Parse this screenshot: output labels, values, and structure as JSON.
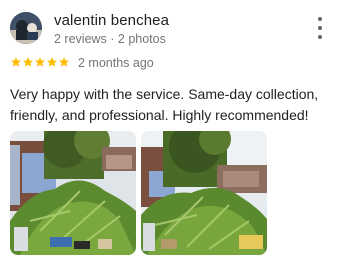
{
  "review": {
    "reviewer_name": "valentin benchea",
    "reviewer_meta": "2 reviews · 2 photos",
    "rating": 5,
    "rating_max": 5,
    "time_ago": "2 months ago",
    "text": "Very happy with the service. Same-day collection, friendly, and professional. Highly recommended!",
    "colors": {
      "star": "#fbbc04",
      "name": "#202124",
      "secondary": "#70757a"
    },
    "icons": [
      "avatar",
      "more-vert-icon",
      "star-icon"
    ],
    "photos": [
      {
        "subject": "garden-waste-pile-photo"
      },
      {
        "subject": "garden-waste-pile-photo"
      }
    ]
  }
}
